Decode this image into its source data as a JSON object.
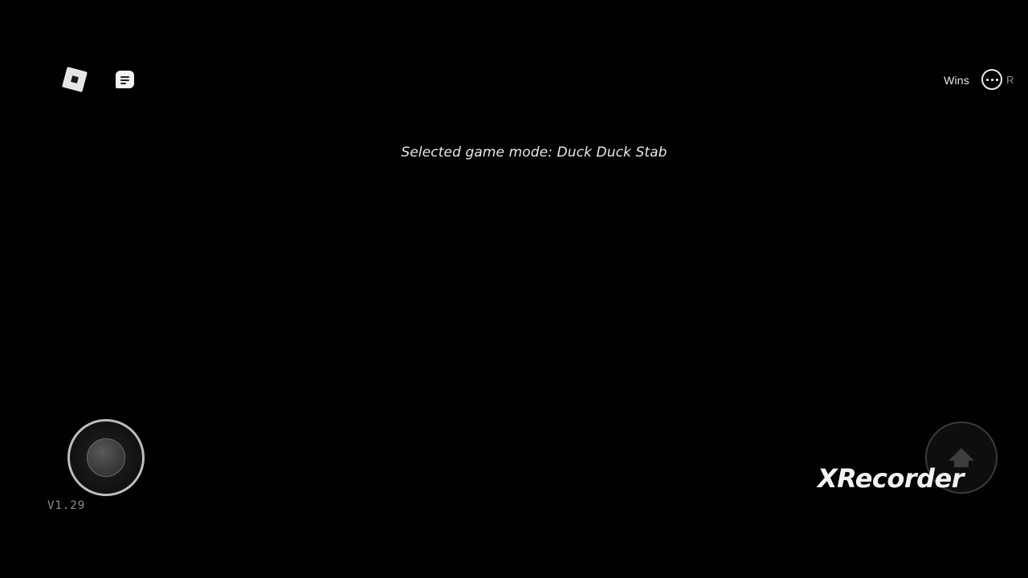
{
  "hud": {
    "message": "Selected game mode: Duck Duck Stab",
    "leaderboard_stat": "Wins",
    "truncated_char": "R",
    "version": "V1.29"
  },
  "controls": {
    "menu_icon": "roblox-logo-icon",
    "chat_icon": "chat-icon",
    "more_icon": "more-options-icon",
    "jump_icon": "jump-arrow-icon"
  },
  "watermark": {
    "text": "XRecorder"
  }
}
